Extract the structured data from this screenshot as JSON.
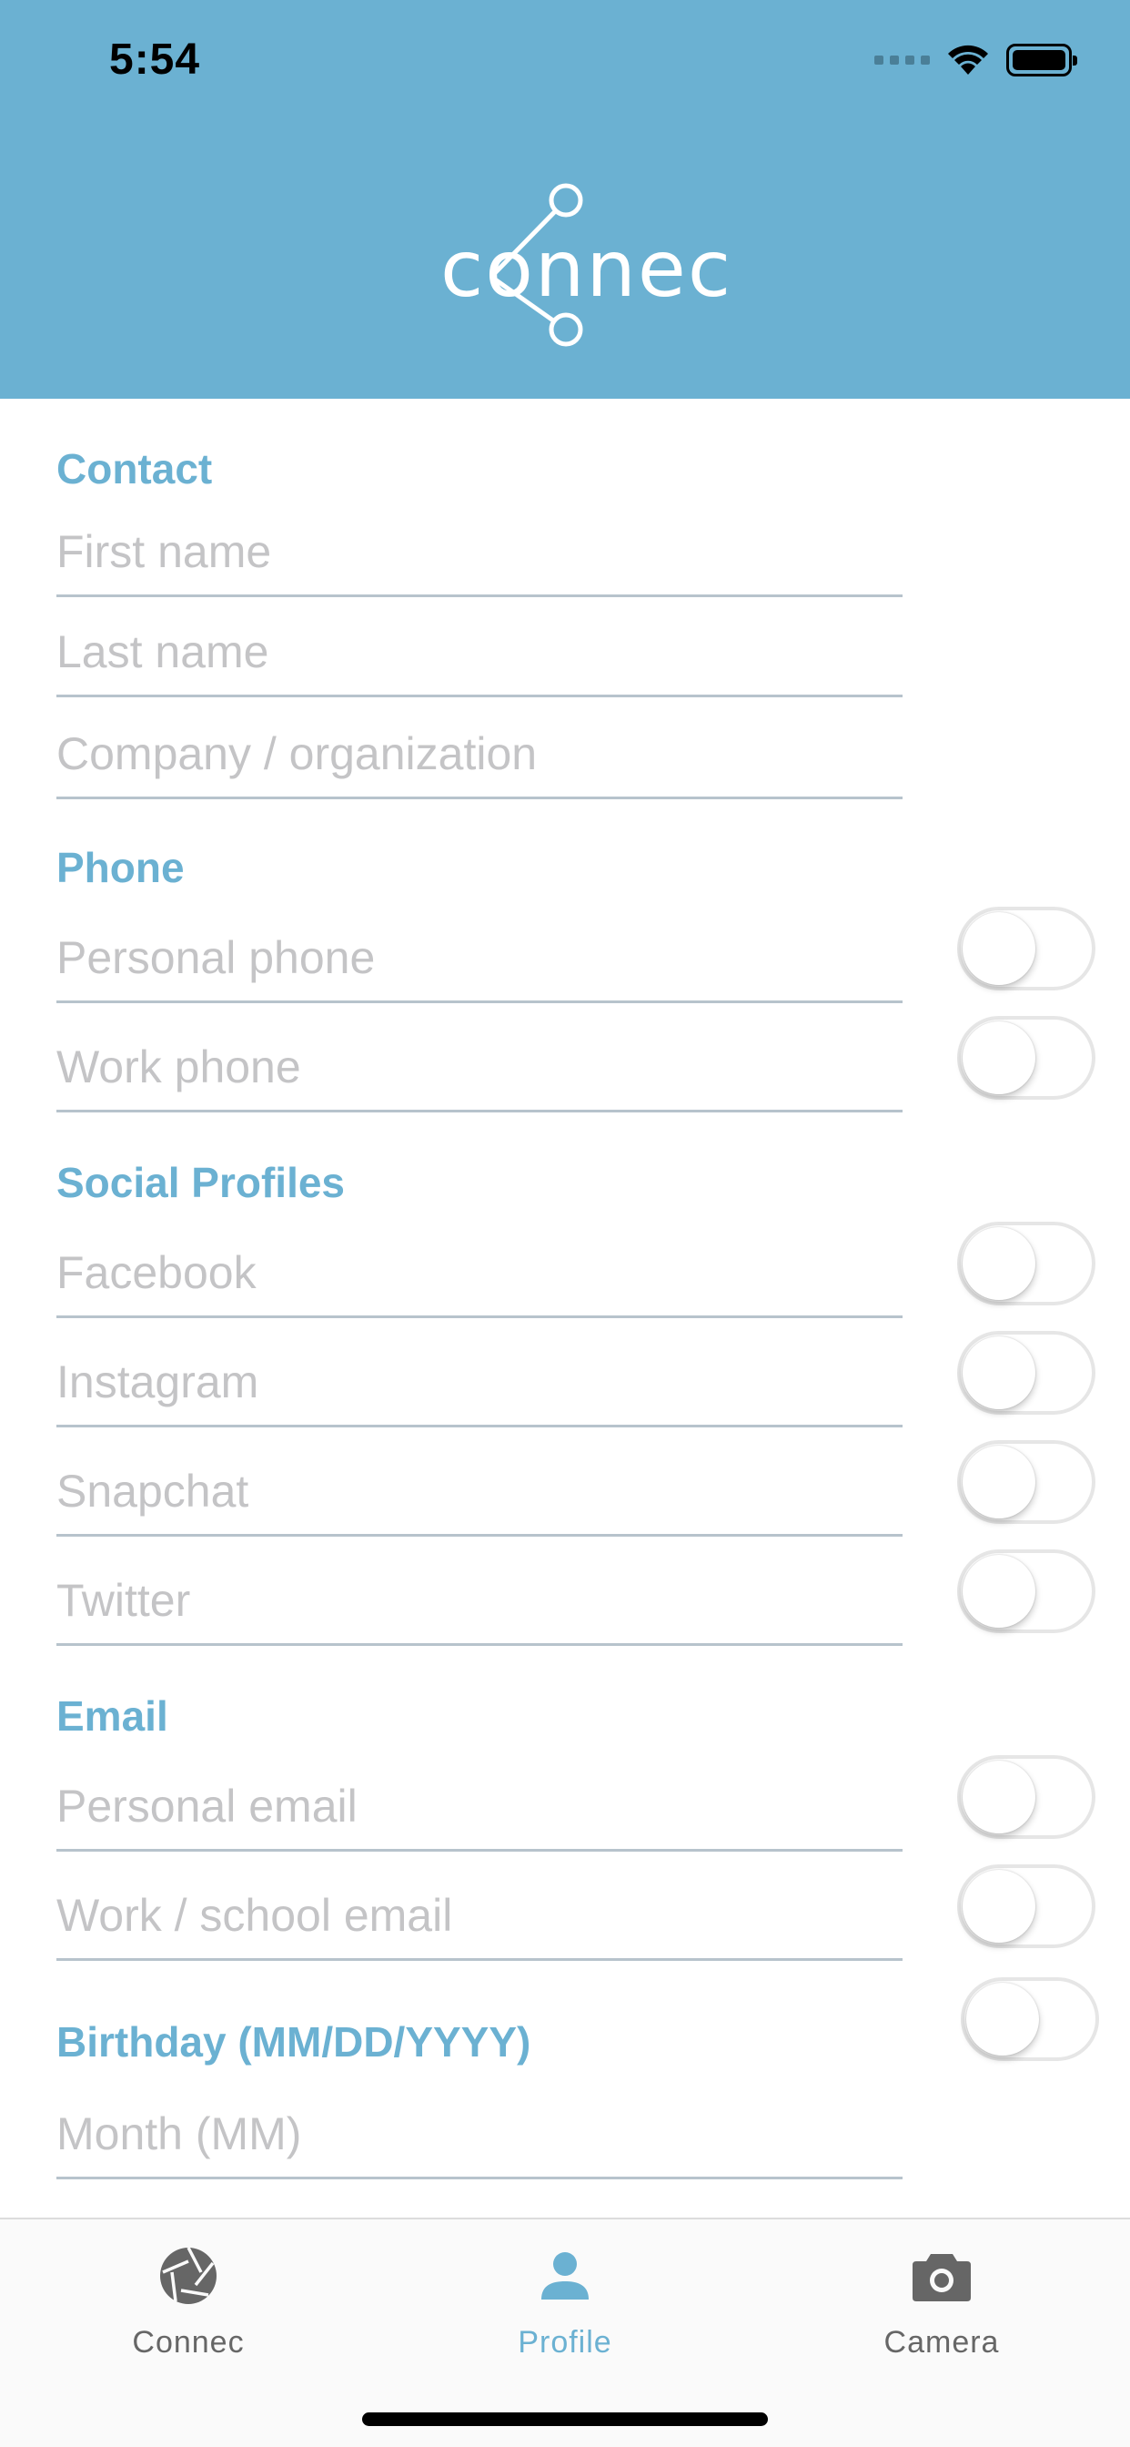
{
  "status_bar": {
    "time": "5:54"
  },
  "header": {
    "logo_text": "connec"
  },
  "sections": {
    "contact": {
      "title": "Contact",
      "first_name_placeholder": "First name",
      "last_name_placeholder": "Last name",
      "company_placeholder": "Company / organization"
    },
    "phone": {
      "title": "Phone",
      "personal_placeholder": "Personal phone",
      "work_placeholder": "Work phone"
    },
    "social": {
      "title": "Social Profiles",
      "facebook_placeholder": "Facebook",
      "instagram_placeholder": "Instagram",
      "snapchat_placeholder": "Snapchat",
      "twitter_placeholder": "Twitter"
    },
    "email": {
      "title": "Email",
      "personal_placeholder": "Personal email",
      "work_placeholder": "Work / school email"
    },
    "birthday": {
      "title": "Birthday (MM/DD/YYYY)",
      "month_placeholder": "Month (MM)"
    }
  },
  "toggles": {
    "personal_phone": false,
    "work_phone": false,
    "facebook": false,
    "instagram": false,
    "snapchat": false,
    "twitter": false,
    "personal_email": false,
    "work_email": false,
    "birthday": false
  },
  "tabs": [
    {
      "label": "Connec",
      "icon": "aperture-icon",
      "active": false
    },
    {
      "label": "Profile",
      "icon": "person-icon",
      "active": true
    },
    {
      "label": "Camera",
      "icon": "camera-icon",
      "active": false
    }
  ],
  "colors": {
    "accent": "#6bb1d2",
    "placeholder": "#c4c4c6",
    "divider": "#b7c3cc"
  }
}
